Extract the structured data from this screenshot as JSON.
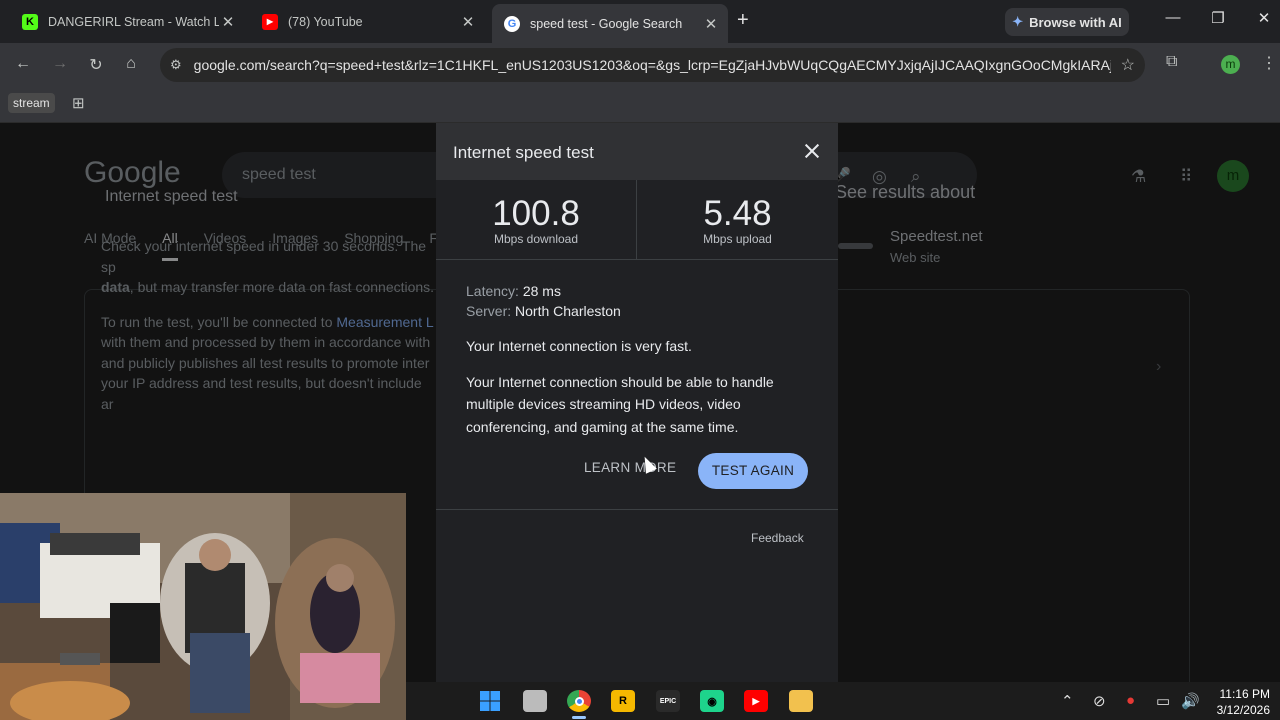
{
  "tabs": [
    {
      "title": "DANGERIRL Stream - Watch Liv",
      "icon": "kick-icon"
    },
    {
      "title": "(78) YouTube",
      "icon": "youtube-icon"
    },
    {
      "title": "speed test - Google Search",
      "icon": "google-icon"
    }
  ],
  "browse_ai_label": "Browse with AI",
  "url": "google.com/search?q=speed+test&rlz=1C1HKFL_enUS1203US1203&oq=&gs_lcrp=EgZjaHJvbWUqCQgAECMYJxjqAjIJCAAQIxgnGOoCMgkIARAj...",
  "profile_initial": "m",
  "bookmarks": {
    "item1": "stream"
  },
  "google": {
    "logo": "Google",
    "query": "speed test",
    "tabs": [
      "AI Mode",
      "All",
      "Videos",
      "Images",
      "Shopping",
      "F"
    ],
    "card_title": "Internet speed test",
    "card_p1_a": "Check your internet speed in under 30 seconds. The sp",
    "card_p1_b": "data",
    "card_p1_c": ", but may transfer more data on fast connections.",
    "card_p2_a": "To run the test, you'll be connected to ",
    "card_p2_link": "Measurement L",
    "card_p2_b": "with them and processed by them in accordance with",
    "card_p2_c": "and publicly publishes all test results to promote inter",
    "card_p2_d": "your IP address and test results, but doesn't include ar",
    "side_heading": "See results about",
    "side_site": "Speedtest.net",
    "side_sub": "Web site"
  },
  "modal": {
    "title": "Internet speed test",
    "download_value": "100.8",
    "download_unit": "Mbps download",
    "upload_value": "5.48",
    "upload_unit": "Mbps upload",
    "latency_label": "Latency: ",
    "latency_value": "28 ms",
    "server_label": "Server: ",
    "server_value": "North Charleston",
    "status": "Your Internet connection is very fast.",
    "description": "Your Internet connection should be able to handle multiple devices streaming HD videos, video conferencing, and gaming at the same time.",
    "learn_more": "LEARN MORE",
    "test_again": "TEST AGAIN",
    "feedback": "Feedback"
  },
  "clock": {
    "time": "11:16 PM",
    "date": "3/12/2026"
  }
}
